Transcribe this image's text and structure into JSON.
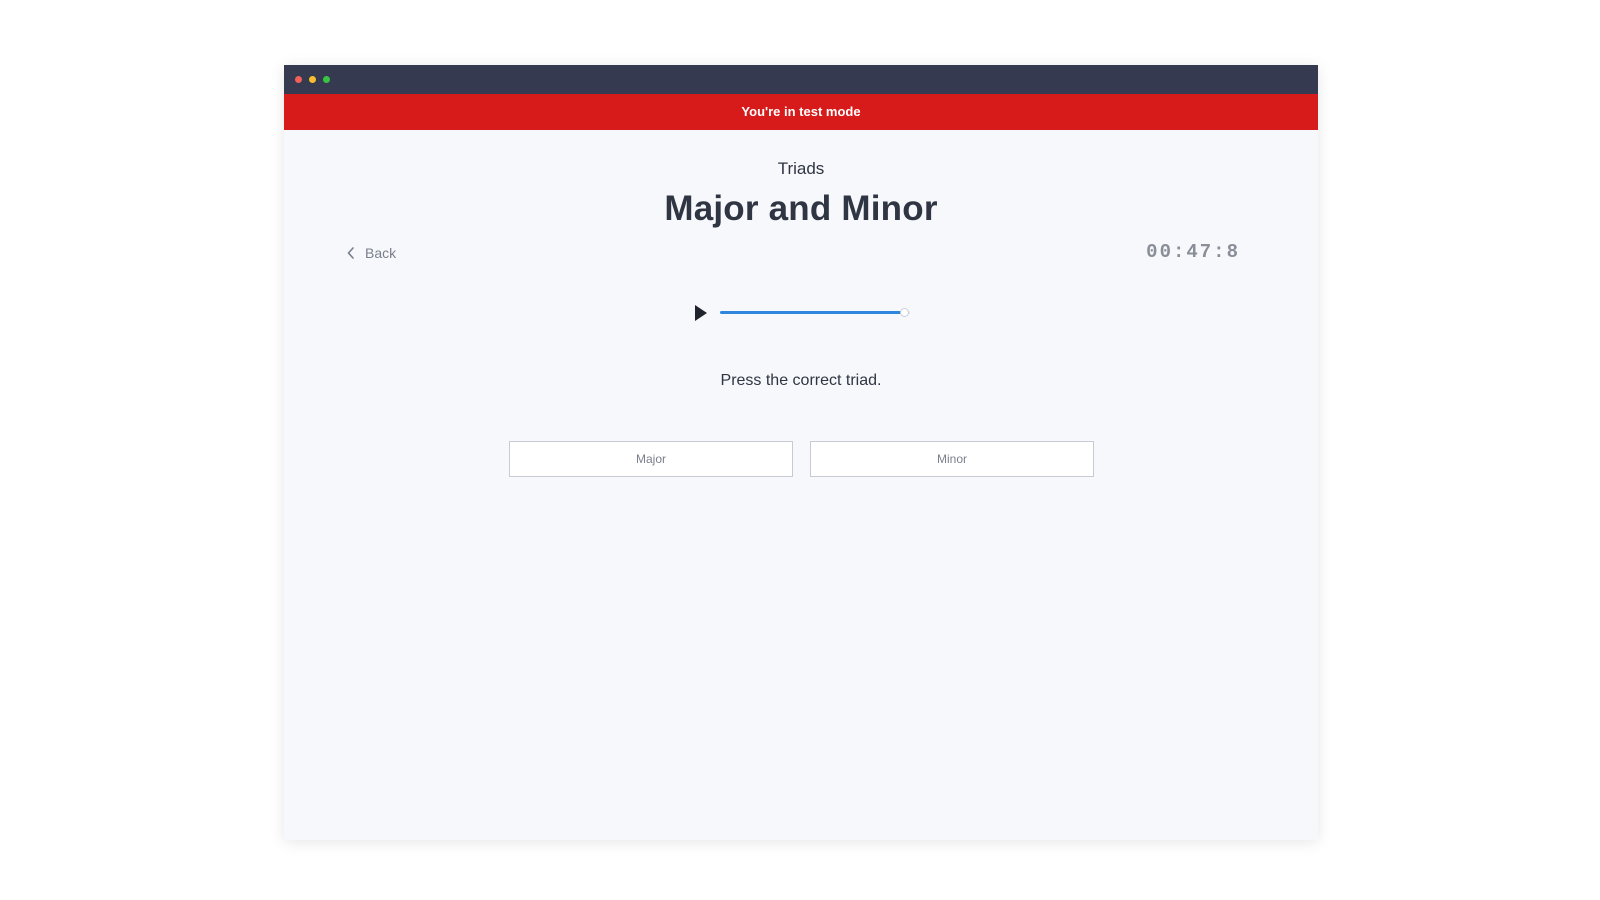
{
  "window": {
    "controls": [
      "close-dot",
      "minimize-dot",
      "maximize-dot"
    ],
    "control_colors": [
      "#f25f58",
      "#f9be2e",
      "#3ac443"
    ],
    "titlebar_color": "#363a51"
  },
  "banner": {
    "text": "You're in test mode",
    "color": "#d71a1a"
  },
  "exercise": {
    "category": "Triads",
    "title": "Major and Minor"
  },
  "nav": {
    "back_label": "Back",
    "back_icon": "chevron-left-icon"
  },
  "timer": {
    "value": "00:47:8"
  },
  "player": {
    "play_icon": "play-icon",
    "progress": 0.97,
    "accent_color": "#2f86dd"
  },
  "question": {
    "prompt": "Press the correct triad."
  },
  "answers": [
    {
      "label": "Major"
    },
    {
      "label": "Minor"
    }
  ]
}
